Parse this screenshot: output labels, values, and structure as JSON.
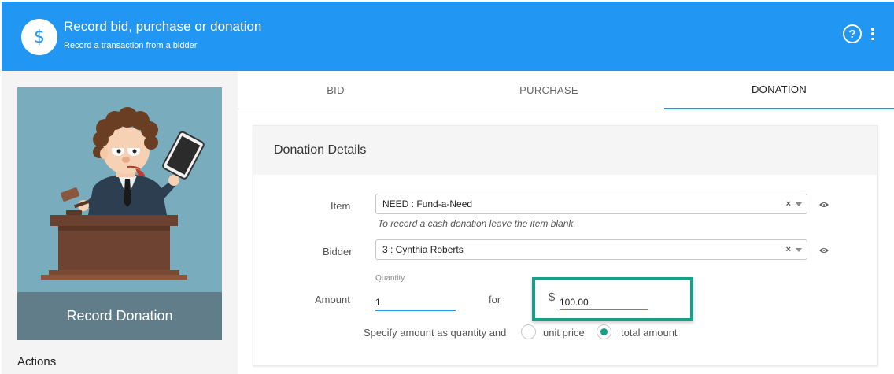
{
  "header": {
    "icon": "dollar-icon",
    "title": "Record bid, purchase or donation",
    "subtitle": "Record a transaction from a bidder"
  },
  "sidebar": {
    "caption": "Record Donation",
    "actions_title": "Actions"
  },
  "tabs": [
    {
      "label": "BID",
      "active": false
    },
    {
      "label": "PURCHASE",
      "active": false
    },
    {
      "label": "DONATION",
      "active": true
    }
  ],
  "card": {
    "title": "Donation Details",
    "item": {
      "label": "Item",
      "value": "NEED : Fund-a-Need",
      "hint": "To record a cash donation leave the item blank."
    },
    "bidder": {
      "label": "Bidder",
      "value": "3 : Cynthia Roberts"
    },
    "amount": {
      "label": "Amount",
      "quantity_label": "Quantity",
      "quantity": "1",
      "for_label": "for",
      "currency": "$",
      "value": "100.00"
    },
    "specify": {
      "label": "Specify amount as quantity and",
      "options": [
        {
          "label": "unit price",
          "selected": false
        },
        {
          "label": "total amount",
          "selected": true
        }
      ]
    },
    "clear_glyph": "×"
  },
  "colors": {
    "header": "#2196f3",
    "accent": "#2196f3",
    "highlight": "#16a085",
    "caption_bg": "#617d8a"
  }
}
